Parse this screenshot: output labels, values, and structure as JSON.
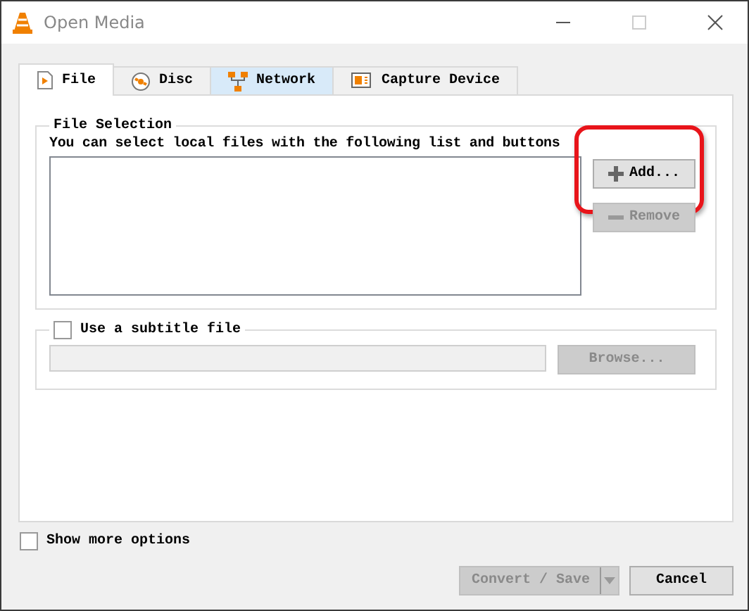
{
  "window": {
    "title": "Open Media"
  },
  "tabs": [
    {
      "label": "File",
      "kind": "file",
      "selected": true,
      "hovered": false
    },
    {
      "label": "Disc",
      "kind": "disc",
      "selected": false,
      "hovered": false
    },
    {
      "label": "Network",
      "kind": "network",
      "selected": false,
      "hovered": true
    },
    {
      "label": "Capture Device",
      "kind": "capture",
      "selected": false,
      "hovered": false
    }
  ],
  "file_selection": {
    "title": "File Selection",
    "hint": "You can select local files with the following list and buttons",
    "buttons": [
      {
        "label": "Add...",
        "kind": "add",
        "disabled": false,
        "highlighted": true
      },
      {
        "label": "Remove",
        "kind": "remove",
        "disabled": true,
        "highlighted": false
      }
    ]
  },
  "subtitle": {
    "label": "Use a subtitle file",
    "checked": false,
    "browse": {
      "label": "Browse...",
      "disabled": true
    }
  },
  "show_more_options": {
    "label": "Show more options",
    "checked": false
  },
  "buttons": [
    {
      "label": "Convert / Save",
      "kind": "split",
      "disabled": true
    },
    {
      "label": "Cancel",
      "kind": "plain",
      "disabled": false
    }
  ]
}
